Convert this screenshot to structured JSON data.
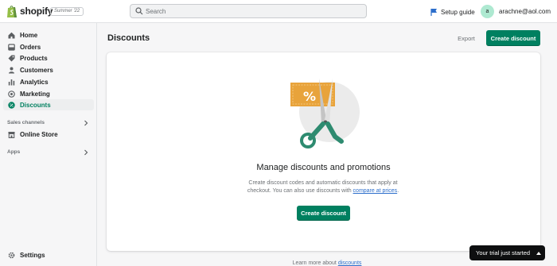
{
  "app": {
    "brand": "shopify",
    "edition_badge": "Summer '22"
  },
  "search": {
    "placeholder": "Search"
  },
  "header": {
    "setup_guide": "Setup guide",
    "avatar_initial": "a",
    "account_email": "arachne@aol.com"
  },
  "sidebar": {
    "items": [
      {
        "label": "Home",
        "icon": "home-icon"
      },
      {
        "label": "Orders",
        "icon": "orders-icon"
      },
      {
        "label": "Products",
        "icon": "tag-icon"
      },
      {
        "label": "Customers",
        "icon": "person-icon"
      },
      {
        "label": "Analytics",
        "icon": "bar-chart-icon"
      },
      {
        "label": "Marketing",
        "icon": "target-icon"
      },
      {
        "label": "Discounts",
        "icon": "discount-icon",
        "active": true
      }
    ],
    "sales_channels_label": "Sales channels",
    "online_store": "Online Store",
    "apps_label": "Apps",
    "settings": "Settings"
  },
  "page": {
    "title": "Discounts",
    "export_label": "Export",
    "create_label": "Create discount"
  },
  "empty_state": {
    "title": "Manage discounts and promotions",
    "description_before": "Create discount codes and automatic discounts that apply at checkout. You can also use discounts with ",
    "description_link": "compare at prices",
    "description_after": ".",
    "button_label": "Create discount"
  },
  "footer": {
    "learn_prefix": "Learn more about ",
    "learn_link": "discounts"
  },
  "trial_banner": {
    "label": "Your trial just started"
  },
  "colors": {
    "accent": "#008060",
    "link": "#2c6ecb",
    "coupon": "#e8a33b",
    "scissors": "#2e8b70"
  }
}
